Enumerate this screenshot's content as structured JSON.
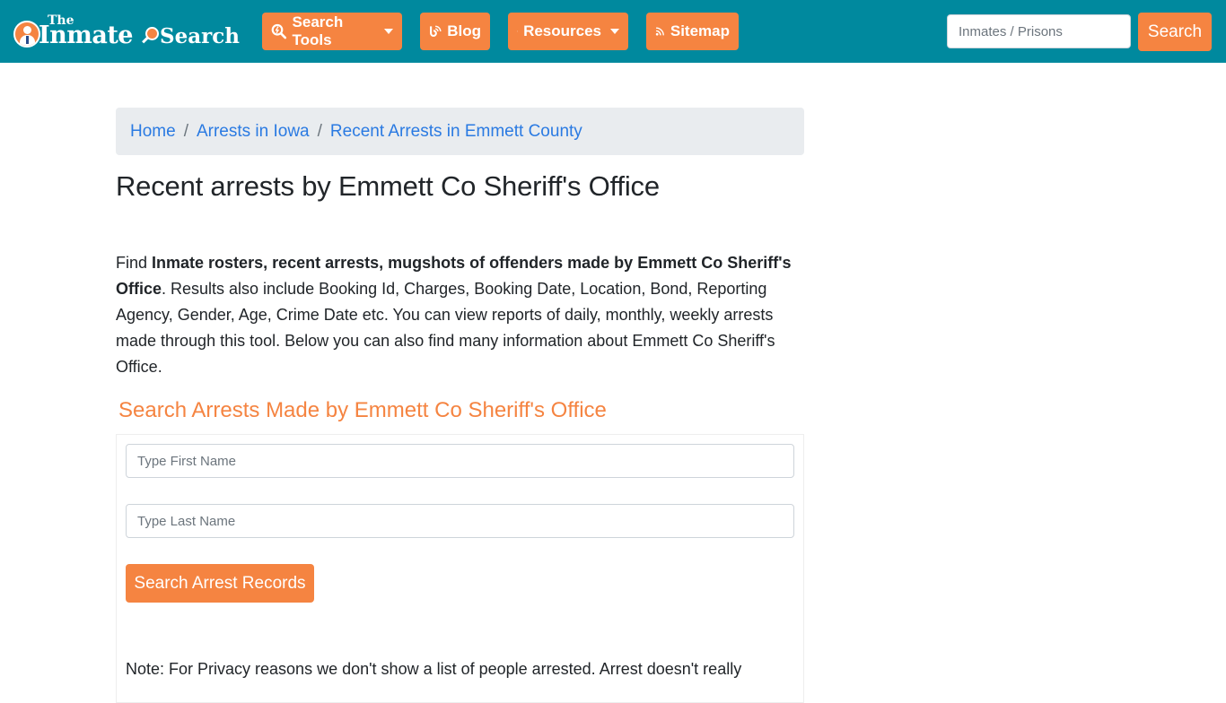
{
  "brand": {
    "the": "The",
    "inmate": "Inmate",
    "search": "Search",
    "colors": {
      "navbar": "#00899e",
      "accent": "#f58441",
      "link": "#2a7ae2"
    }
  },
  "nav": {
    "items": [
      {
        "label": "Search Tools",
        "icon": "search-tools-icon",
        "dropdown": true
      },
      {
        "label": "Blog",
        "icon": "blog-icon",
        "dropdown": false
      },
      {
        "label": "Resources",
        "icon": "leaf-icon",
        "dropdown": true
      },
      {
        "label": "Sitemap",
        "icon": "rss-icon",
        "dropdown": false
      }
    ],
    "search_placeholder": "Inmates / Prisons",
    "search_button": "Search"
  },
  "breadcrumb": [
    {
      "label": "Home"
    },
    {
      "label": "Arrests in Iowa"
    },
    {
      "label": "Recent Arrests in Emmett County"
    }
  ],
  "breadcrumb_sep": "/",
  "page": {
    "title": "Recent arrests by Emmett Co Sheriff's Office",
    "intro_prefix": "Find ",
    "intro_bold": "Inmate rosters, recent arrests, mugshots of offenders made by Emmett Co Sheriff's Office",
    "intro_rest": ". Results also include Booking Id, Charges, Booking Date, Location, Bond, Reporting Agency, Gender, Age, Crime Date etc. You can view reports of daily, monthly, weekly arrests made through this tool. Below you can also find many information about Emmett Co Sheriff's Office."
  },
  "search_form": {
    "title": "Search Arrests Made by Emmett Co Sheriff's Office",
    "first_name_placeholder": "Type First Name",
    "last_name_placeholder": "Type Last Name",
    "first_name_value": "",
    "last_name_value": "",
    "submit_label": "Search Arrest Records",
    "note": "Note: For Privacy reasons we don't show a list of people arrested. Arrest doesn't really"
  }
}
